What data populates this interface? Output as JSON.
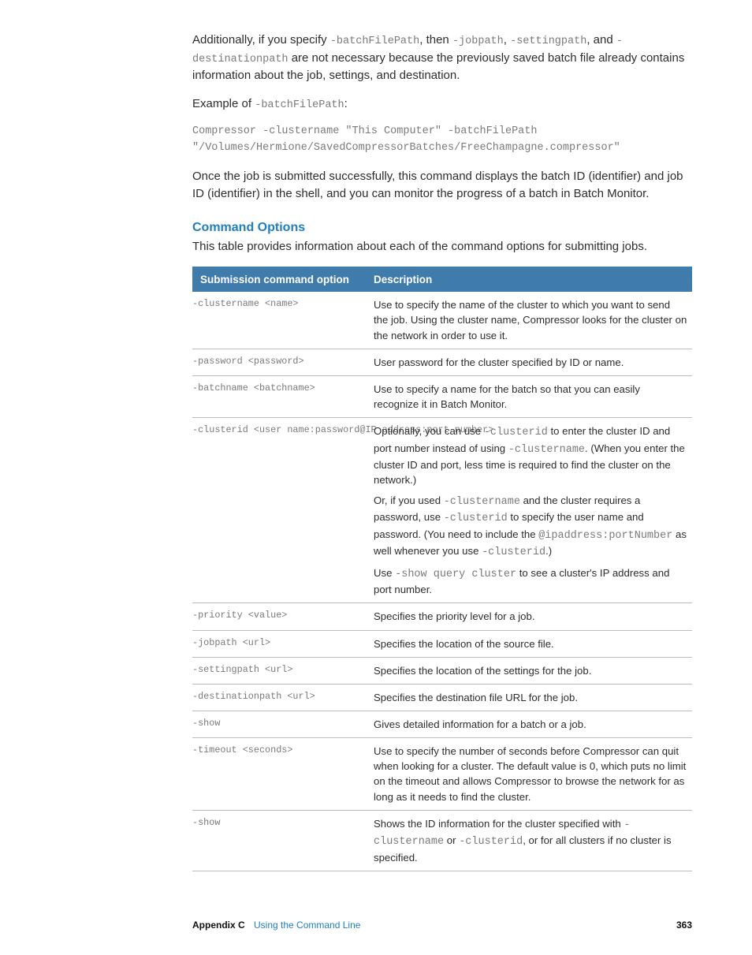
{
  "intro": {
    "p1a": "Additionally, if you specify ",
    "c1": "-batchFilePath",
    "p1b": ", then ",
    "c2": "-jobpath",
    "p1c": ", ",
    "c3": "-settingpath",
    "p1d": ", and ",
    "c4": "-destinationpath",
    "p1e": " are not necessary because the previously saved batch file already contains information about the job, settings, and destination.",
    "p2a": "Example of ",
    "c5": "-batchFilePath",
    "p2b": ":",
    "code_line": "Compressor -clustername \"This Computer\" -batchFilePath \"/Volumes/Hermione/SavedCompressorBatches/FreeChampagne.compressor\"",
    "p3": "Once the job is submitted successfully, this command displays the batch ID (identifier) and job ID (identifier) in the shell, and you can monitor the progress of a batch in Batch Monitor."
  },
  "section": {
    "heading": "Command Options",
    "intro": "This table provides information about each of the command options for submitting jobs."
  },
  "table": {
    "head_opt": "Submission command option",
    "head_desc": "Description",
    "rows": [
      {
        "opt": "-clustername <name>",
        "desc": [
          {
            "t": "Use to specify the name of the cluster to which you want to send the job. Using the cluster name, Compressor looks for the cluster on the network in order to use it."
          }
        ]
      },
      {
        "opt": "-password <password>",
        "desc": [
          {
            "t": "User password for the cluster specified by ID or name."
          }
        ]
      },
      {
        "opt": "-batchname <batchname>",
        "desc": [
          {
            "t": "Use to specify a name for the batch so that you can easily recognize it in Batch Monitor."
          }
        ]
      },
      {
        "opt": "-clusterid <user name:password@IP address:port number>",
        "desc": [
          {
            "segments": [
              {
                "t": "Optionally, you can use "
              },
              {
                "c": "-clusterid"
              },
              {
                "t": " to enter the cluster ID and port number instead of using "
              },
              {
                "c": "-clustername"
              },
              {
                "t": ". (When you enter the cluster ID and port, less time is required to find the cluster on the network.)"
              }
            ]
          },
          {
            "segments": [
              {
                "t": "Or, if you used "
              },
              {
                "c": "-clustername"
              },
              {
                "t": " and the cluster requires a password, use "
              },
              {
                "c": "-clusterid"
              },
              {
                "t": " to specify the user name and password. (You need to include the "
              },
              {
                "c": "@ipaddress:portNumber"
              },
              {
                "t": " as well whenever you use "
              },
              {
                "c": "-clusterid"
              },
              {
                "t": ".)"
              }
            ]
          },
          {
            "segments": [
              {
                "t": "Use "
              },
              {
                "c": "-show query cluster"
              },
              {
                "t": " to see a cluster's IP address and port number."
              }
            ]
          }
        ]
      },
      {
        "opt": "-priority <value>",
        "desc": [
          {
            "t": "Specifies the priority level for a job."
          }
        ]
      },
      {
        "opt": "-jobpath <url>",
        "desc": [
          {
            "t": "Specifies the location of the source file."
          }
        ]
      },
      {
        "opt": "-settingpath <url>",
        "desc": [
          {
            "t": "Specifies the location of the settings for the job."
          }
        ]
      },
      {
        "opt": "-destinationpath <url>",
        "desc": [
          {
            "t": "Specifies the destination file URL for the job."
          }
        ]
      },
      {
        "opt": "-show",
        "desc": [
          {
            "t": "Gives detailed information for a batch or a job."
          }
        ]
      },
      {
        "opt": "-timeout <seconds>",
        "desc": [
          {
            "t": "Use to specify the number of seconds before Compressor can quit when looking for a cluster. The default value is 0, which puts no limit on the timeout and allows Compressor to browse the network for as long as it needs to find the cluster."
          }
        ]
      },
      {
        "opt": "-show",
        "desc": [
          {
            "segments": [
              {
                "t": "Shows the ID information for the cluster specified with "
              },
              {
                "c": "-clustername"
              },
              {
                "t": " or "
              },
              {
                "c": "-clusterid"
              },
              {
                "t": ", or for all clusters if no cluster is specified."
              }
            ]
          }
        ]
      }
    ]
  },
  "footer": {
    "appendix": "Appendix C",
    "chapter": "Using the Command Line",
    "page": "363"
  }
}
